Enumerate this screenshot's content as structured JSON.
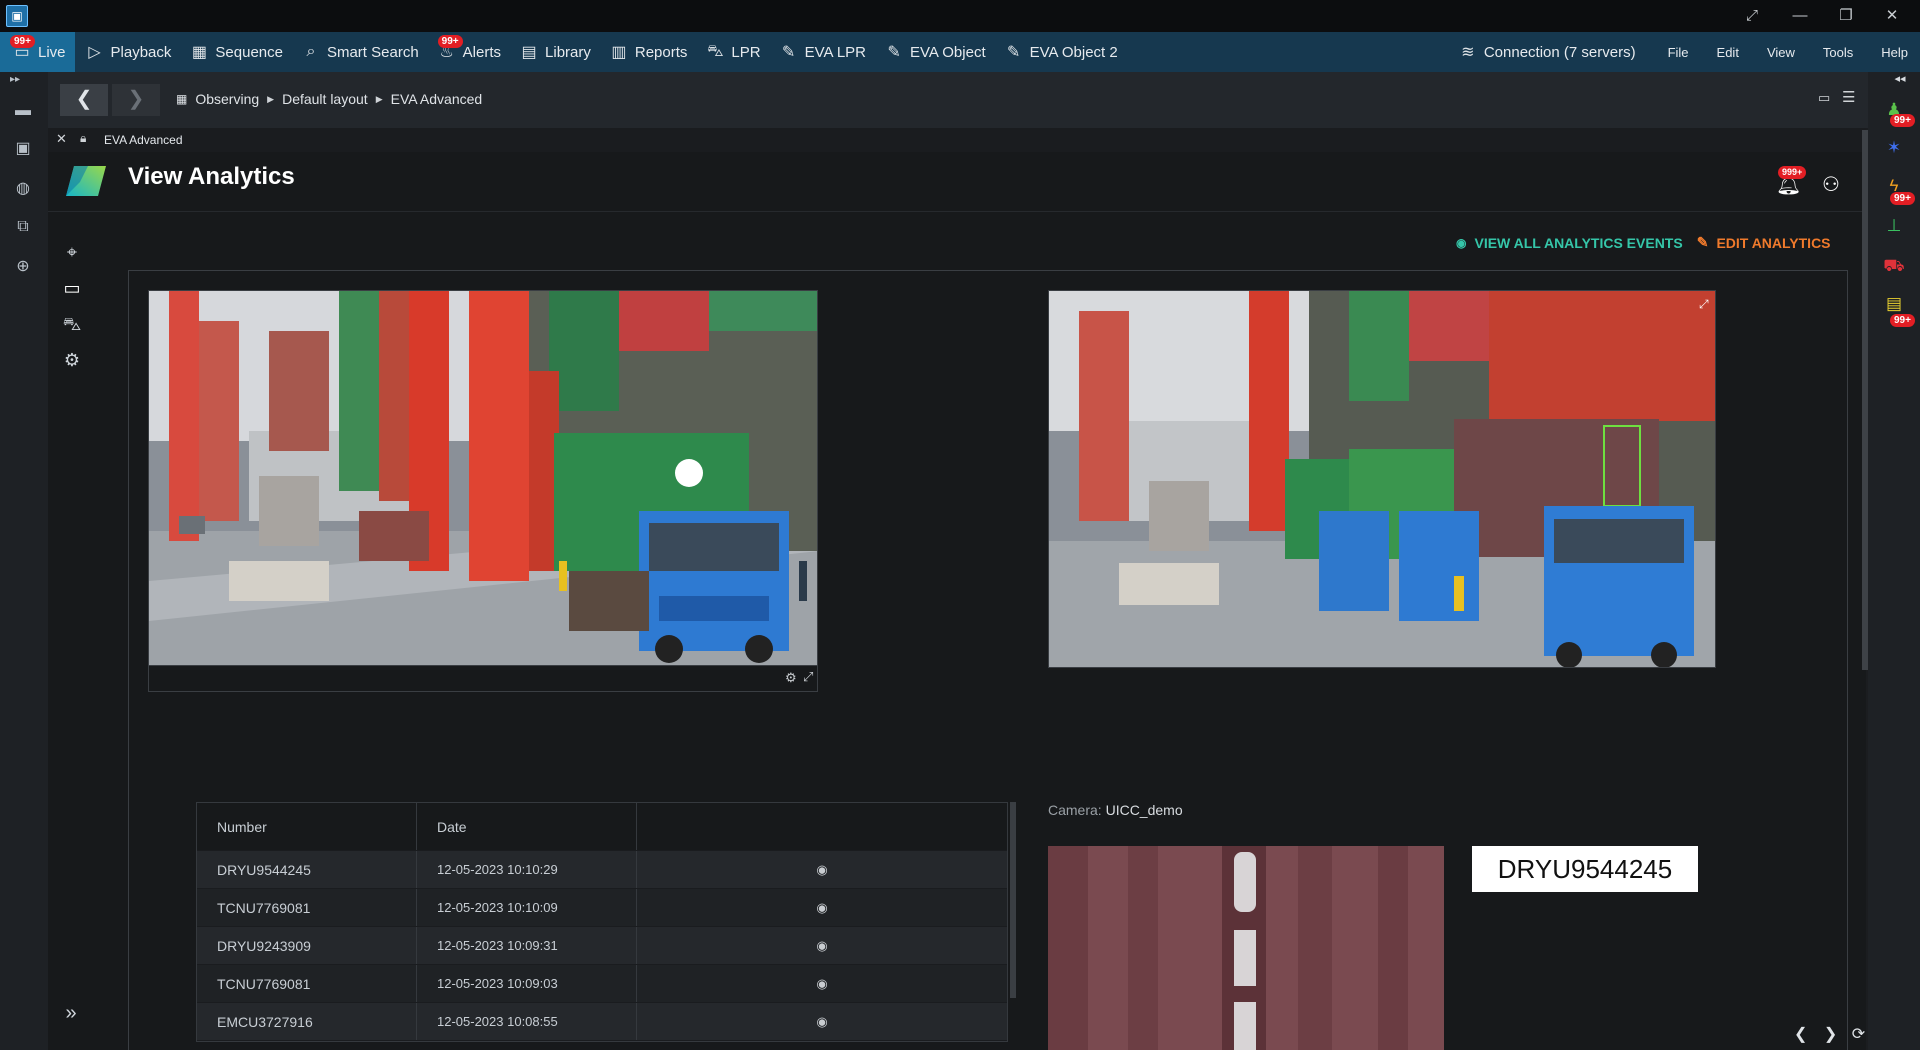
{
  "titlebar": {
    "logo_glyph": "▣",
    "controls": [
      "⤢",
      "—",
      "❐",
      "✕"
    ]
  },
  "menubar": {
    "items": [
      {
        "label": "Live",
        "icon": "monitor-icon",
        "badge": "99+",
        "active": true
      },
      {
        "label": "Playback",
        "icon": "play-icon"
      },
      {
        "label": "Sequence",
        "icon": "grid-icon"
      },
      {
        "label": "Smart Search",
        "icon": "smart-search-icon"
      },
      {
        "label": "Alerts",
        "icon": "alerts-icon",
        "badge": "99+"
      },
      {
        "label": "Library",
        "icon": "library-icon"
      },
      {
        "label": "Reports",
        "icon": "reports-icon"
      },
      {
        "label": "LPR",
        "icon": "car-icon"
      },
      {
        "label": "EVA LPR",
        "icon": "edit-icon"
      },
      {
        "label": "EVA Object",
        "icon": "edit-icon"
      },
      {
        "label": "EVA Object 2",
        "icon": "edit-icon"
      }
    ],
    "connection": "Connection (7 servers)",
    "right_menu": [
      "File",
      "Edit",
      "View",
      "Tools",
      "Help"
    ]
  },
  "navbar": {
    "back": "❮",
    "forward": "❯",
    "breadcrumb": [
      "Observing",
      "Default layout",
      "EVA Advanced"
    ]
  },
  "tab": {
    "close": "✕",
    "title": "EVA Advanced"
  },
  "app": {
    "title": "View Analytics",
    "notification_badge": "999+",
    "actions": {
      "view_all": "VIEW ALL ANALYTICS EVENTS",
      "edit": "EDIT ANALYTICS"
    },
    "camera_label": "Camera:",
    "camera_name": "UICC_demo",
    "plate_text": "DRYU9544245"
  },
  "table": {
    "headers": [
      "Number",
      "Date",
      ""
    ],
    "rows": [
      {
        "number": "DRYU9544245",
        "date": "12-05-2023 10:10:29"
      },
      {
        "number": "TCNU7769081",
        "date": "12-05-2023 10:10:09"
      },
      {
        "number": "DRYU9243909",
        "date": "12-05-2023 10:09:31"
      },
      {
        "number": "TCNU7769081",
        "date": "12-05-2023 10:09:03"
      },
      {
        "number": "EMCU3727916",
        "date": "12-05-2023 10:08:55"
      }
    ]
  },
  "right_rail": {
    "badges": [
      "99+",
      "99+",
      "99+"
    ]
  },
  "colors": {
    "menubar": "#16384f",
    "active_tab": "#1a6b98",
    "accent_green": "#35c6a9",
    "accent_orange": "#f07a2c",
    "badge_red": "#e31e24"
  }
}
